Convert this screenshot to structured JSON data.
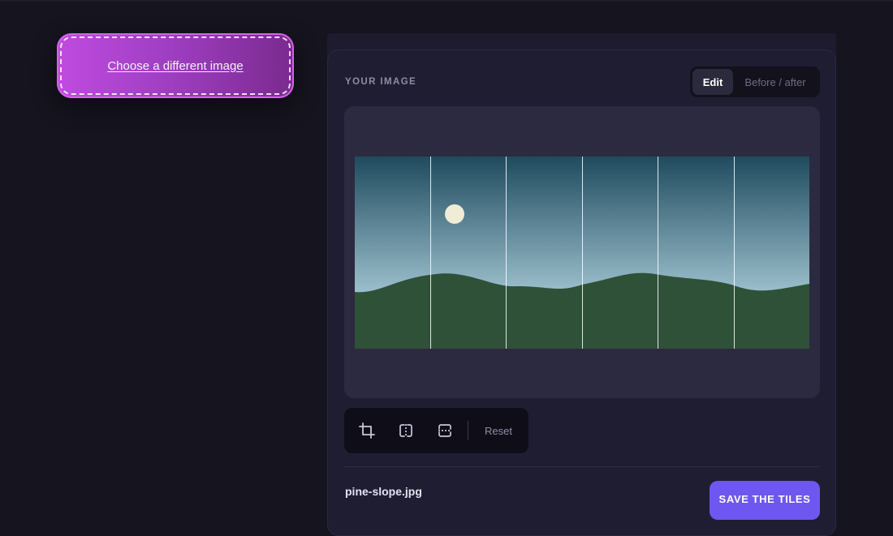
{
  "chooser": {
    "label": "Choose a different image"
  },
  "panel": {
    "title": "YOUR IMAGE",
    "view_toggle": {
      "options": [
        "Edit",
        "Before / after"
      ],
      "selected": "Edit"
    }
  },
  "image": {
    "tile_columns": 6,
    "colors": {
      "sky_top": "#1f4b5e",
      "sky_bottom": "#a3c6d3",
      "hills": "#2f5138",
      "sun": "#f1ecd6"
    }
  },
  "toolbar": {
    "tools": [
      {
        "icon": "crop-icon"
      },
      {
        "icon": "split-vertical-icon"
      },
      {
        "icon": "split-horizontal-icon"
      }
    ],
    "reset_label": "Reset"
  },
  "footer": {
    "filename": "pine-slope.jpg",
    "save_label": "SAVE THE TILES"
  },
  "colors": {
    "accent": "#6e56f0",
    "chooser_gradient": [
      "#c04be0",
      "#7a2a8e"
    ]
  }
}
